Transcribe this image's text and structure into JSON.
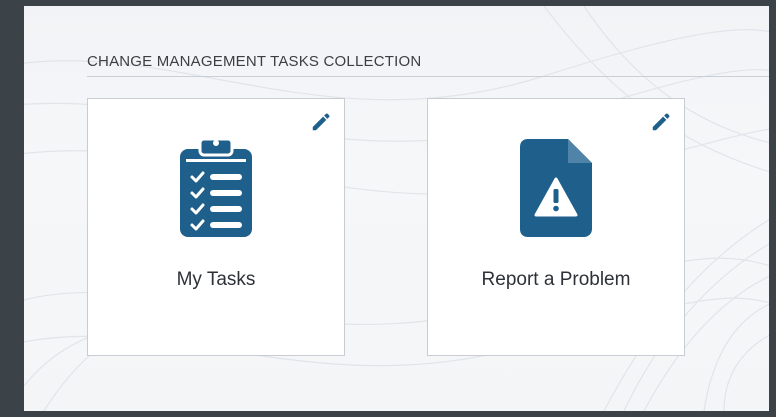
{
  "section": {
    "title": "CHANGE MANAGEMENT TASKS COLLECTION"
  },
  "tiles": [
    {
      "label": "My Tasks",
      "icon": "clipboard-checklist-icon",
      "edit_icon": "pencil-icon"
    },
    {
      "label": "Report a Problem",
      "icon": "warning-document-icon",
      "edit_icon": "pencil-icon"
    }
  ],
  "colors": {
    "accent": "#1f5f8b",
    "frame": "#3c4348",
    "tile_border": "#c8cdd3",
    "text": "#2d3238"
  }
}
